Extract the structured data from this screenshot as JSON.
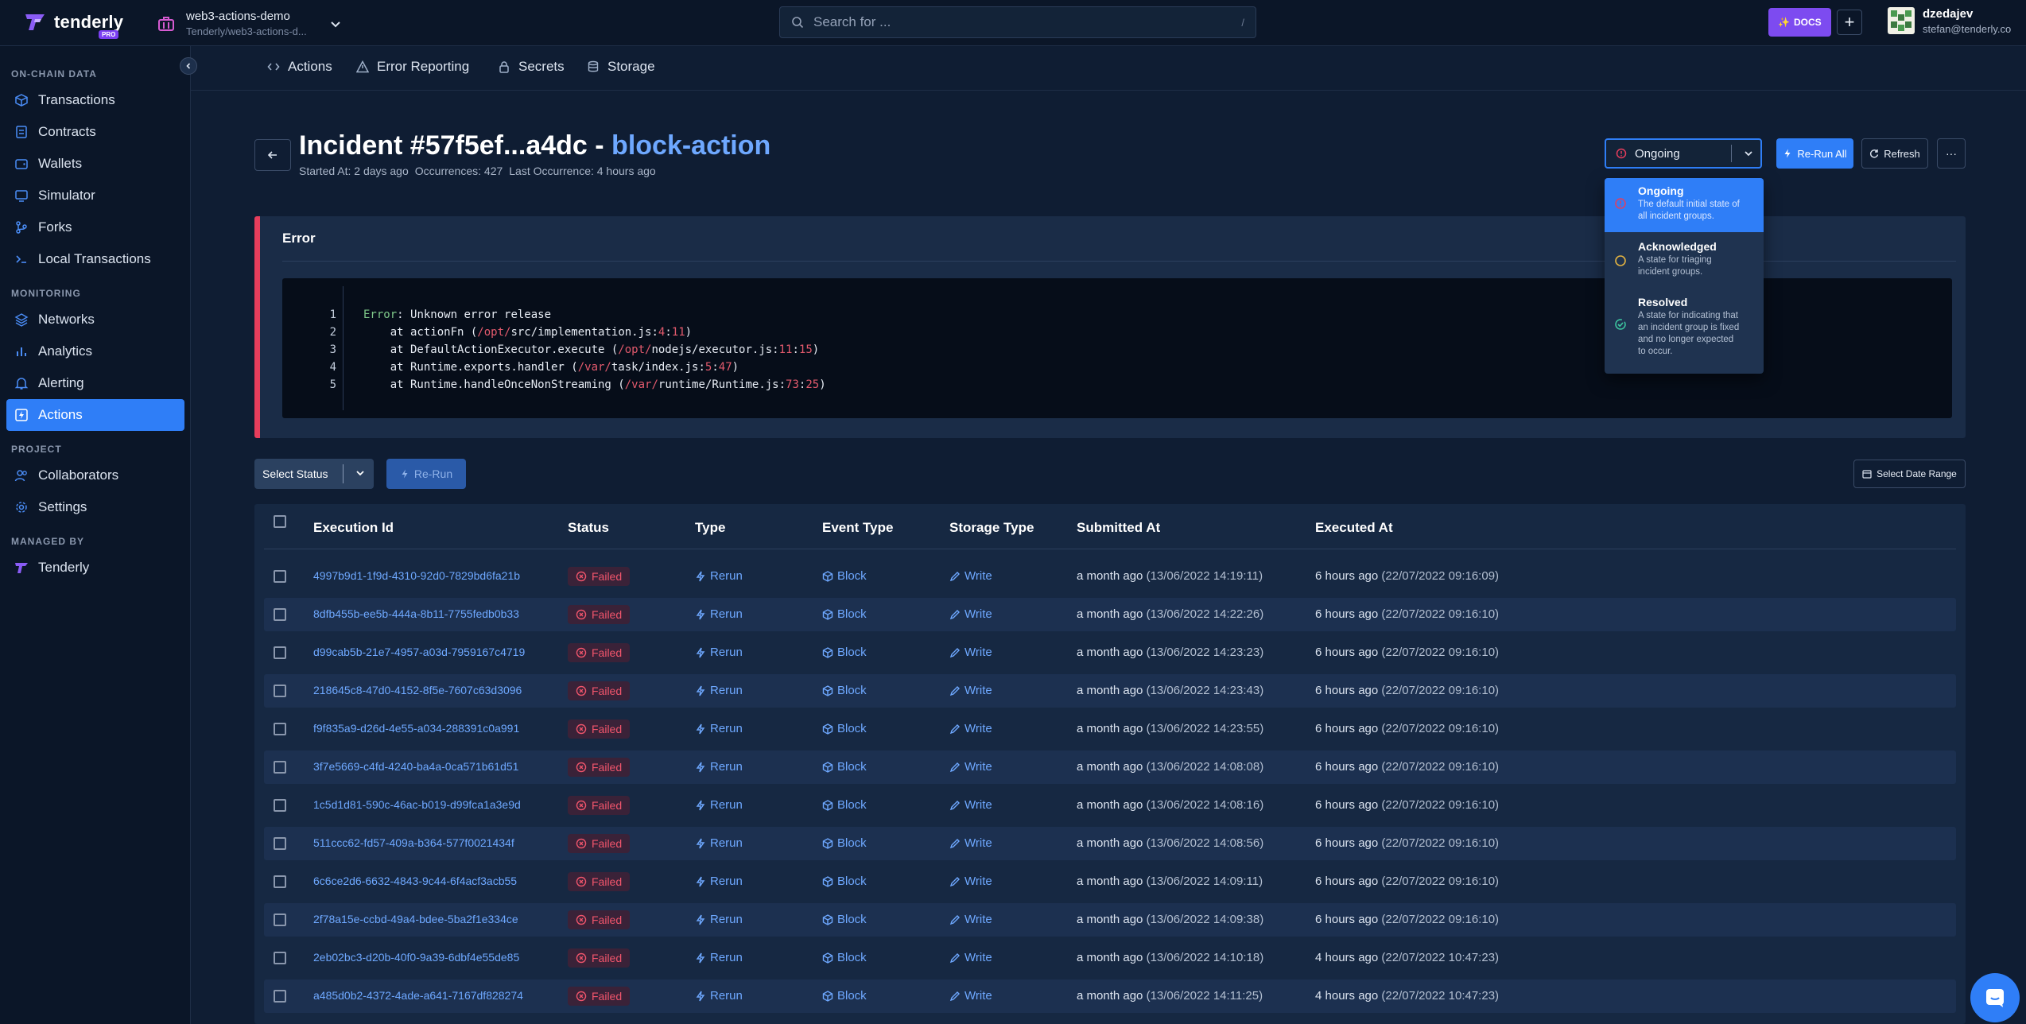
{
  "app": {
    "logo_text": "tenderly",
    "logo_badge": "PRO",
    "project_name": "web3-actions-demo",
    "project_path": "Tenderly/web3-actions-d...",
    "search_placeholder": "Search for ...",
    "search_shortcut": "/",
    "docs_label": "DOCS",
    "user_name": "dzedajev",
    "user_email": "stefan@tenderly.co"
  },
  "sidebar": {
    "sections": [
      {
        "title": "ON-CHAIN DATA"
      },
      {
        "title": "MONITORING"
      },
      {
        "title": "PROJECT"
      },
      {
        "title": "MANAGED BY"
      }
    ],
    "items": [
      {
        "label": "Transactions",
        "icon": "cube-icon"
      },
      {
        "label": "Contracts",
        "icon": "document-icon"
      },
      {
        "label": "Wallets",
        "icon": "wallet-icon"
      },
      {
        "label": "Simulator",
        "icon": "monitor-icon"
      },
      {
        "label": "Forks",
        "icon": "fork-icon"
      },
      {
        "label": "Local Transactions",
        "icon": "terminal-icon"
      },
      {
        "label": "Networks",
        "icon": "layers-icon"
      },
      {
        "label": "Analytics",
        "icon": "bar-chart-icon"
      },
      {
        "label": "Alerting",
        "icon": "bell-icon"
      },
      {
        "label": "Actions",
        "icon": "lightning-icon",
        "active": true
      },
      {
        "label": "Collaborators",
        "icon": "users-icon"
      },
      {
        "label": "Settings",
        "icon": "gear-icon"
      },
      {
        "label": "Tenderly",
        "icon": "tenderly-logo-icon"
      }
    ]
  },
  "subtabs": [
    {
      "label": "Actions",
      "icon": "code-icon"
    },
    {
      "label": "Error Reporting",
      "icon": "warning-icon"
    },
    {
      "label": "Secrets",
      "icon": "lock-icon"
    },
    {
      "label": "Storage",
      "icon": "database-icon"
    }
  ],
  "incident": {
    "title_main": "Incident #57f5ef...a4dc",
    "title_sep": "-",
    "title_accent": "block-action",
    "started_at": "Started At: 2 days ago",
    "occurrences": "Occurrences: 427",
    "last_occurrence": "Last Occurrence: 4 hours ago",
    "status_value": "Ongoing",
    "rerun_all_label": "Re-Run All",
    "refresh_label": "Refresh",
    "more_label": "···"
  },
  "status_dropdown": {
    "options": [
      {
        "title": "Ongoing",
        "desc": [
          "The default initial state of",
          "all incident groups."
        ],
        "icon": "alert-circle-icon",
        "selected": true
      },
      {
        "title": "Acknowledged",
        "desc": [
          "A state for triaging",
          "incident groups."
        ],
        "icon": "circle-outline-icon"
      },
      {
        "title": "Resolved",
        "desc": [
          "A state for indicating that",
          "an incident group is fixed",
          "and no longer expected",
          "to occur."
        ],
        "icon": "check-circle-icon"
      }
    ]
  },
  "error_panel": {
    "heading": "Error",
    "lines": [
      {
        "num": "1",
        "parts": [
          {
            "t": "Error",
            "c": "g"
          },
          {
            "t": ": Unknown error release",
            "c": ""
          }
        ]
      },
      {
        "num": "2",
        "parts": [
          {
            "t": "    at actionFn (",
            "c": ""
          },
          {
            "t": "/opt/",
            "c": "r"
          },
          {
            "t": "src/implementation.js:",
            "c": ""
          },
          {
            "t": "4",
            "c": "r"
          },
          {
            "t": ":",
            "c": ""
          },
          {
            "t": "11",
            "c": "r"
          },
          {
            "t": ")",
            "c": ""
          }
        ]
      },
      {
        "num": "3",
        "parts": [
          {
            "t": "    at DefaultActionExecutor.execute (",
            "c": ""
          },
          {
            "t": "/opt/",
            "c": "r"
          },
          {
            "t": "nodejs/executor.js:",
            "c": ""
          },
          {
            "t": "11",
            "c": "r"
          },
          {
            "t": ":",
            "c": ""
          },
          {
            "t": "15",
            "c": "r"
          },
          {
            "t": ")",
            "c": ""
          }
        ]
      },
      {
        "num": "4",
        "parts": [
          {
            "t": "    at Runtime.exports.handler (",
            "c": ""
          },
          {
            "t": "/var/",
            "c": "r"
          },
          {
            "t": "task/index.js:",
            "c": ""
          },
          {
            "t": "5",
            "c": "r"
          },
          {
            "t": ":",
            "c": ""
          },
          {
            "t": "47",
            "c": "r"
          },
          {
            "t": ")",
            "c": ""
          }
        ]
      },
      {
        "num": "5",
        "parts": [
          {
            "t": "    at Runtime.handleOnceNonStreaming (",
            "c": ""
          },
          {
            "t": "/var/",
            "c": "r"
          },
          {
            "t": "runtime/Runtime.js:",
            "c": ""
          },
          {
            "t": "73",
            "c": "r"
          },
          {
            "t": ":",
            "c": ""
          },
          {
            "t": "25",
            "c": "r"
          },
          {
            "t": ")",
            "c": ""
          }
        ]
      }
    ]
  },
  "filters": {
    "select_status_label": "Select Status",
    "rerun_label": "Re-Run",
    "date_range_label": "Select Date Range"
  },
  "table": {
    "columns": [
      "Execution Id",
      "Status",
      "Type",
      "Event Type",
      "Storage Type",
      "Submitted At",
      "Executed At"
    ],
    "rows": [
      {
        "id": "4997b9d1-1f9d-4310-92d0-7829bd6fa21b",
        "status": "Failed",
        "type": "Rerun",
        "event": "Block",
        "storage": "Write",
        "submitted": "a month ago",
        "submitted_abs": "(13/06/2022 14:19:11)",
        "executed": "6 hours ago",
        "executed_abs": "(22/07/2022 09:16:09)"
      },
      {
        "id": "8dfb455b-ee5b-444a-8b11-7755fedb0b33",
        "status": "Failed",
        "type": "Rerun",
        "event": "Block",
        "storage": "Write",
        "submitted": "a month ago",
        "submitted_abs": "(13/06/2022 14:22:26)",
        "executed": "6 hours ago",
        "executed_abs": "(22/07/2022 09:16:10)"
      },
      {
        "id": "d99cab5b-21e7-4957-a03d-7959167c4719",
        "status": "Failed",
        "type": "Rerun",
        "event": "Block",
        "storage": "Write",
        "submitted": "a month ago",
        "submitted_abs": "(13/06/2022 14:23:23)",
        "executed": "6 hours ago",
        "executed_abs": "(22/07/2022 09:16:10)"
      },
      {
        "id": "218645c8-47d0-4152-8f5e-7607c63d3096",
        "status": "Failed",
        "type": "Rerun",
        "event": "Block",
        "storage": "Write",
        "submitted": "a month ago",
        "submitted_abs": "(13/06/2022 14:23:43)",
        "executed": "6 hours ago",
        "executed_abs": "(22/07/2022 09:16:10)"
      },
      {
        "id": "f9f835a9-d26d-4e55-a034-288391c0a991",
        "status": "Failed",
        "type": "Rerun",
        "event": "Block",
        "storage": "Write",
        "submitted": "a month ago",
        "submitted_abs": "(13/06/2022 14:23:55)",
        "executed": "6 hours ago",
        "executed_abs": "(22/07/2022 09:16:10)"
      },
      {
        "id": "3f7e5669-c4fd-4240-ba4a-0ca571b61d51",
        "status": "Failed",
        "type": "Rerun",
        "event": "Block",
        "storage": "Write",
        "submitted": "a month ago",
        "submitted_abs": "(13/06/2022 14:08:08)",
        "executed": "6 hours ago",
        "executed_abs": "(22/07/2022 09:16:10)"
      },
      {
        "id": "1c5d1d81-590c-46ac-b019-d99fca1a3e9d",
        "status": "Failed",
        "type": "Rerun",
        "event": "Block",
        "storage": "Write",
        "submitted": "a month ago",
        "submitted_abs": "(13/06/2022 14:08:16)",
        "executed": "6 hours ago",
        "executed_abs": "(22/07/2022 09:16:10)"
      },
      {
        "id": "511ccc62-fd57-409a-b364-577f0021434f",
        "status": "Failed",
        "type": "Rerun",
        "event": "Block",
        "storage": "Write",
        "submitted": "a month ago",
        "submitted_abs": "(13/06/2022 14:08:56)",
        "executed": "6 hours ago",
        "executed_abs": "(22/07/2022 09:16:10)"
      },
      {
        "id": "6c6ce2d6-6632-4843-9c44-6f4acf3acb55",
        "status": "Failed",
        "type": "Rerun",
        "event": "Block",
        "storage": "Write",
        "submitted": "a month ago",
        "submitted_abs": "(13/06/2022 14:09:11)",
        "executed": "6 hours ago",
        "executed_abs": "(22/07/2022 09:16:10)"
      },
      {
        "id": "2f78a15e-ccbd-49a4-bdee-5ba2f1e334ce",
        "status": "Failed",
        "type": "Rerun",
        "event": "Block",
        "storage": "Write",
        "submitted": "a month ago",
        "submitted_abs": "(13/06/2022 14:09:38)",
        "executed": "6 hours ago",
        "executed_abs": "(22/07/2022 09:16:10)"
      },
      {
        "id": "2eb02bc3-d20b-40f0-9a39-6dbf4e55de85",
        "status": "Failed",
        "type": "Rerun",
        "event": "Block",
        "storage": "Write",
        "submitted": "a month ago",
        "submitted_abs": "(13/06/2022 14:10:18)",
        "executed": "4 hours ago",
        "executed_abs": "(22/07/2022 10:47:23)"
      },
      {
        "id": "a485d0b2-4372-4ade-a641-7167df828274",
        "status": "Failed",
        "type": "Rerun",
        "event": "Block",
        "storage": "Write",
        "submitted": "a month ago",
        "submitted_abs": "(13/06/2022 14:11:25)",
        "executed": "4 hours ago",
        "executed_abs": "(22/07/2022 10:47:23)"
      }
    ]
  },
  "colors": {
    "accent": "#2f7ef7",
    "danger": "#e63d5c",
    "docs": "#7d4bf0",
    "link": "#6ea8ff"
  }
}
